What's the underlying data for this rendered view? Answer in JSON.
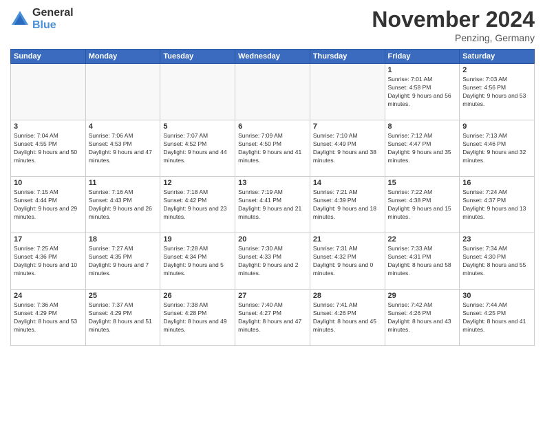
{
  "logo": {
    "general": "General",
    "blue": "Blue"
  },
  "title": "November 2024",
  "location": "Penzing, Germany",
  "days_header": [
    "Sunday",
    "Monday",
    "Tuesday",
    "Wednesday",
    "Thursday",
    "Friday",
    "Saturday"
  ],
  "weeks": [
    [
      {
        "day": "",
        "info": ""
      },
      {
        "day": "",
        "info": ""
      },
      {
        "day": "",
        "info": ""
      },
      {
        "day": "",
        "info": ""
      },
      {
        "day": "",
        "info": ""
      },
      {
        "day": "1",
        "info": "Sunrise: 7:01 AM\nSunset: 4:58 PM\nDaylight: 9 hours and 56 minutes."
      },
      {
        "day": "2",
        "info": "Sunrise: 7:03 AM\nSunset: 4:56 PM\nDaylight: 9 hours and 53 minutes."
      }
    ],
    [
      {
        "day": "3",
        "info": "Sunrise: 7:04 AM\nSunset: 4:55 PM\nDaylight: 9 hours and 50 minutes."
      },
      {
        "day": "4",
        "info": "Sunrise: 7:06 AM\nSunset: 4:53 PM\nDaylight: 9 hours and 47 minutes."
      },
      {
        "day": "5",
        "info": "Sunrise: 7:07 AM\nSunset: 4:52 PM\nDaylight: 9 hours and 44 minutes."
      },
      {
        "day": "6",
        "info": "Sunrise: 7:09 AM\nSunset: 4:50 PM\nDaylight: 9 hours and 41 minutes."
      },
      {
        "day": "7",
        "info": "Sunrise: 7:10 AM\nSunset: 4:49 PM\nDaylight: 9 hours and 38 minutes."
      },
      {
        "day": "8",
        "info": "Sunrise: 7:12 AM\nSunset: 4:47 PM\nDaylight: 9 hours and 35 minutes."
      },
      {
        "day": "9",
        "info": "Sunrise: 7:13 AM\nSunset: 4:46 PM\nDaylight: 9 hours and 32 minutes."
      }
    ],
    [
      {
        "day": "10",
        "info": "Sunrise: 7:15 AM\nSunset: 4:44 PM\nDaylight: 9 hours and 29 minutes."
      },
      {
        "day": "11",
        "info": "Sunrise: 7:16 AM\nSunset: 4:43 PM\nDaylight: 9 hours and 26 minutes."
      },
      {
        "day": "12",
        "info": "Sunrise: 7:18 AM\nSunset: 4:42 PM\nDaylight: 9 hours and 23 minutes."
      },
      {
        "day": "13",
        "info": "Sunrise: 7:19 AM\nSunset: 4:41 PM\nDaylight: 9 hours and 21 minutes."
      },
      {
        "day": "14",
        "info": "Sunrise: 7:21 AM\nSunset: 4:39 PM\nDaylight: 9 hours and 18 minutes."
      },
      {
        "day": "15",
        "info": "Sunrise: 7:22 AM\nSunset: 4:38 PM\nDaylight: 9 hours and 15 minutes."
      },
      {
        "day": "16",
        "info": "Sunrise: 7:24 AM\nSunset: 4:37 PM\nDaylight: 9 hours and 13 minutes."
      }
    ],
    [
      {
        "day": "17",
        "info": "Sunrise: 7:25 AM\nSunset: 4:36 PM\nDaylight: 9 hours and 10 minutes."
      },
      {
        "day": "18",
        "info": "Sunrise: 7:27 AM\nSunset: 4:35 PM\nDaylight: 9 hours and 7 minutes."
      },
      {
        "day": "19",
        "info": "Sunrise: 7:28 AM\nSunset: 4:34 PM\nDaylight: 9 hours and 5 minutes."
      },
      {
        "day": "20",
        "info": "Sunrise: 7:30 AM\nSunset: 4:33 PM\nDaylight: 9 hours and 2 minutes."
      },
      {
        "day": "21",
        "info": "Sunrise: 7:31 AM\nSunset: 4:32 PM\nDaylight: 9 hours and 0 minutes."
      },
      {
        "day": "22",
        "info": "Sunrise: 7:33 AM\nSunset: 4:31 PM\nDaylight: 8 hours and 58 minutes."
      },
      {
        "day": "23",
        "info": "Sunrise: 7:34 AM\nSunset: 4:30 PM\nDaylight: 8 hours and 55 minutes."
      }
    ],
    [
      {
        "day": "24",
        "info": "Sunrise: 7:36 AM\nSunset: 4:29 PM\nDaylight: 8 hours and 53 minutes."
      },
      {
        "day": "25",
        "info": "Sunrise: 7:37 AM\nSunset: 4:29 PM\nDaylight: 8 hours and 51 minutes."
      },
      {
        "day": "26",
        "info": "Sunrise: 7:38 AM\nSunset: 4:28 PM\nDaylight: 8 hours and 49 minutes."
      },
      {
        "day": "27",
        "info": "Sunrise: 7:40 AM\nSunset: 4:27 PM\nDaylight: 8 hours and 47 minutes."
      },
      {
        "day": "28",
        "info": "Sunrise: 7:41 AM\nSunset: 4:26 PM\nDaylight: 8 hours and 45 minutes."
      },
      {
        "day": "29",
        "info": "Sunrise: 7:42 AM\nSunset: 4:26 PM\nDaylight: 8 hours and 43 minutes."
      },
      {
        "day": "30",
        "info": "Sunrise: 7:44 AM\nSunset: 4:25 PM\nDaylight: 8 hours and 41 minutes."
      }
    ]
  ]
}
